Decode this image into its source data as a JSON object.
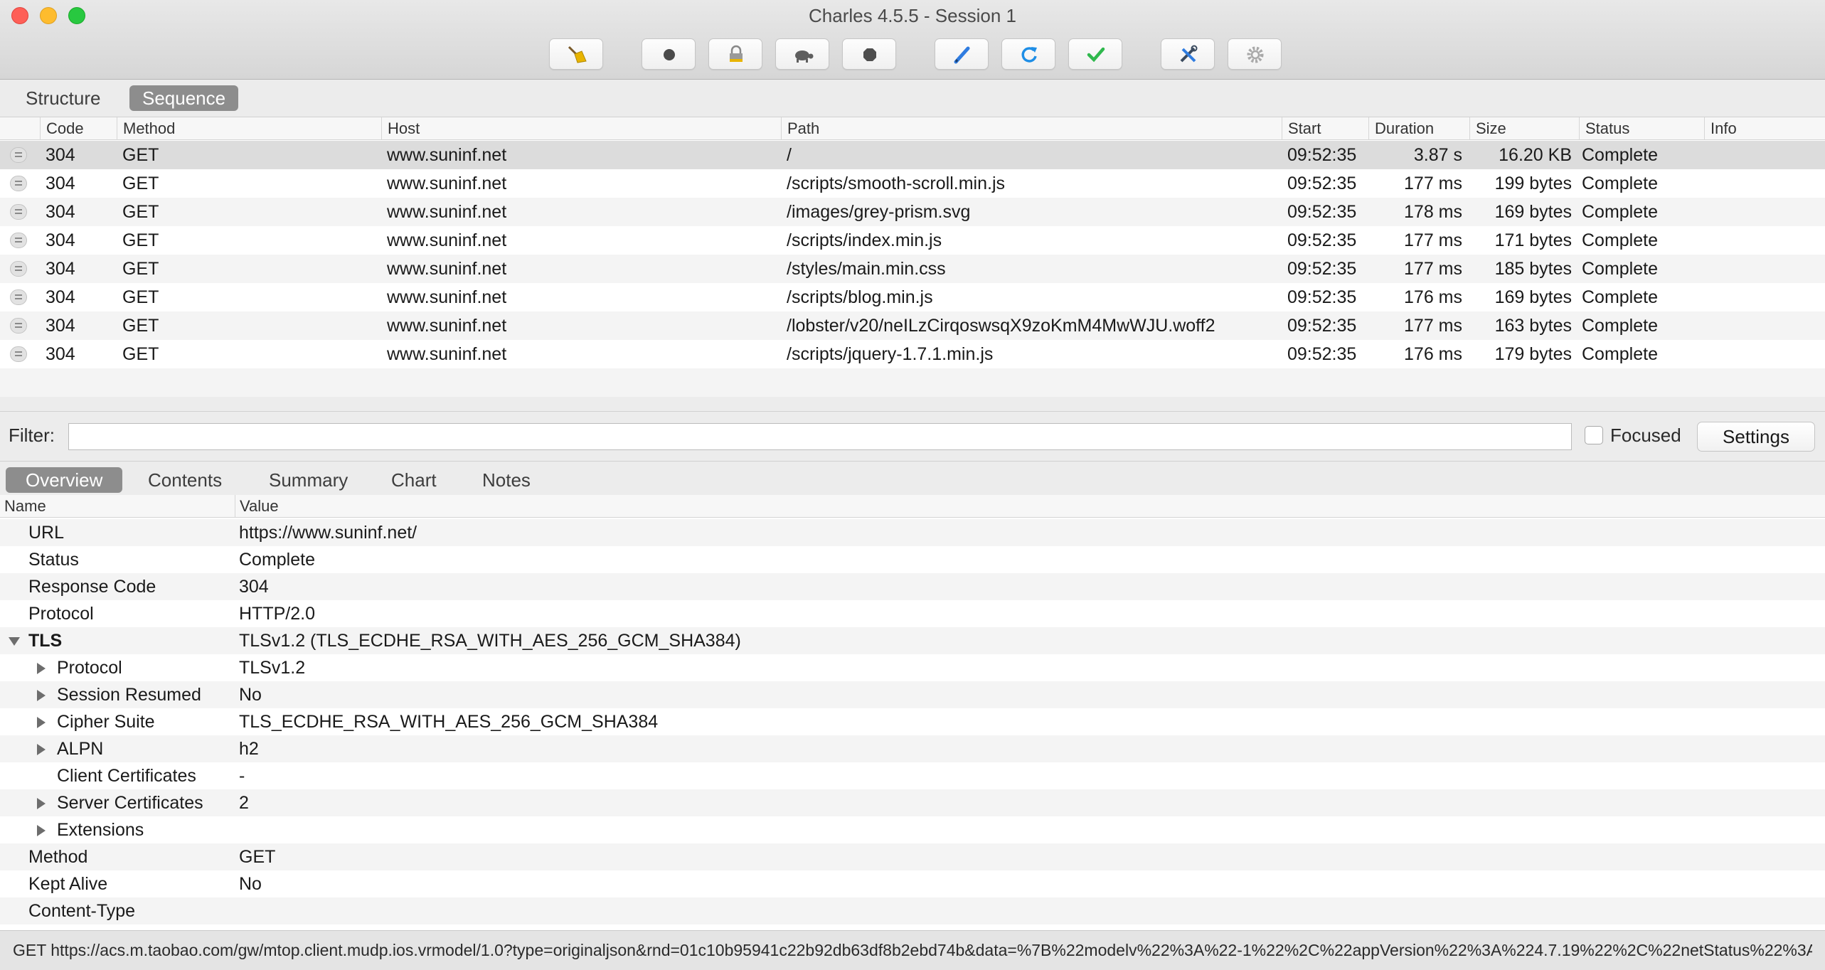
{
  "window": {
    "title": "Charles 4.5.5 - Session 1"
  },
  "toolbar": {
    "icons": [
      "broom-icon",
      "record-icon",
      "ssl-lock-icon",
      "turtle-throttle-icon",
      "breakpoint-stop-icon",
      "compose-pen-icon",
      "repeat-refresh-icon",
      "validate-check-icon",
      "tools-icon",
      "settings-gear-icon"
    ],
    "colors": {
      "pen": "#2f7ce0",
      "refresh": "#1e8ee6",
      "check": "#2fb84d",
      "broom": "#e8b400"
    }
  },
  "view_tabs": [
    "Structure",
    "Sequence"
  ],
  "view_tabs_active": "Sequence",
  "requests": {
    "columns": [
      "Code",
      "Method",
      "Host",
      "Path",
      "Start",
      "Duration",
      "Size",
      "Status",
      "Info"
    ],
    "rows": [
      {
        "code": "304",
        "method": "GET",
        "host": "www.suninf.net",
        "path": "/",
        "start": "09:52:35",
        "duration": "3.87 s",
        "size": "16.20 KB",
        "status": "Complete",
        "info": ""
      },
      {
        "code": "304",
        "method": "GET",
        "host": "www.suninf.net",
        "path": "/scripts/smooth-scroll.min.js",
        "start": "09:52:35",
        "duration": "177 ms",
        "size": "199 bytes",
        "status": "Complete",
        "info": ""
      },
      {
        "code": "304",
        "method": "GET",
        "host": "www.suninf.net",
        "path": "/images/grey-prism.svg",
        "start": "09:52:35",
        "duration": "178 ms",
        "size": "169 bytes",
        "status": "Complete",
        "info": ""
      },
      {
        "code": "304",
        "method": "GET",
        "host": "www.suninf.net",
        "path": "/scripts/index.min.js",
        "start": "09:52:35",
        "duration": "177 ms",
        "size": "171 bytes",
        "status": "Complete",
        "info": ""
      },
      {
        "code": "304",
        "method": "GET",
        "host": "www.suninf.net",
        "path": "/styles/main.min.css",
        "start": "09:52:35",
        "duration": "177 ms",
        "size": "185 bytes",
        "status": "Complete",
        "info": ""
      },
      {
        "code": "304",
        "method": "GET",
        "host": "www.suninf.net",
        "path": "/scripts/blog.min.js",
        "start": "09:52:35",
        "duration": "176 ms",
        "size": "169 bytes",
        "status": "Complete",
        "info": ""
      },
      {
        "code": "304",
        "method": "GET",
        "host": "www.suninf.net",
        "path": "/lobster/v20/neILzCirqoswsqX9zoKmM4MwWJU.woff2",
        "start": "09:52:35",
        "duration": "177 ms",
        "size": "163 bytes",
        "status": "Complete",
        "info": ""
      },
      {
        "code": "304",
        "method": "GET",
        "host": "www.suninf.net",
        "path": "/scripts/jquery-1.7.1.min.js",
        "start": "09:52:35",
        "duration": "176 ms",
        "size": "179 bytes",
        "status": "Complete",
        "info": ""
      }
    ]
  },
  "filter": {
    "label": "Filter:",
    "value": "",
    "placeholder": "",
    "focused_label": "Focused",
    "settings_label": "Settings"
  },
  "detail_tabs": [
    "Overview",
    "Contents",
    "Summary",
    "Chart",
    "Notes"
  ],
  "detail_tabs_active": "Overview",
  "overview": {
    "columns": [
      "Name",
      "Value"
    ],
    "rows": [
      {
        "name": "URL",
        "value": "https://www.suninf.net/",
        "level": 0,
        "toggle": "none",
        "bold": false
      },
      {
        "name": "Status",
        "value": "Complete",
        "level": 0,
        "toggle": "none",
        "bold": false
      },
      {
        "name": "Response Code",
        "value": "304",
        "level": 0,
        "toggle": "none",
        "bold": false
      },
      {
        "name": "Protocol",
        "value": "HTTP/2.0",
        "level": 0,
        "toggle": "none",
        "bold": false
      },
      {
        "name": "TLS",
        "value": "TLSv1.2 (TLS_ECDHE_RSA_WITH_AES_256_GCM_SHA384)",
        "level": 0,
        "toggle": "expanded",
        "bold": true
      },
      {
        "name": "Protocol",
        "value": "TLSv1.2",
        "level": 1,
        "toggle": "collapsed",
        "bold": false
      },
      {
        "name": "Session Resumed",
        "value": "No",
        "level": 1,
        "toggle": "collapsed",
        "bold": false
      },
      {
        "name": "Cipher Suite",
        "value": "TLS_ECDHE_RSA_WITH_AES_256_GCM_SHA384",
        "level": 1,
        "toggle": "collapsed",
        "bold": false
      },
      {
        "name": "ALPN",
        "value": "h2",
        "level": 1,
        "toggle": "collapsed",
        "bold": false
      },
      {
        "name": "Client Certificates",
        "value": "-",
        "level": 1,
        "toggle": "none",
        "bold": false
      },
      {
        "name": "Server Certificates",
        "value": "2",
        "level": 1,
        "toggle": "collapsed",
        "bold": false
      },
      {
        "name": "Extensions",
        "value": "",
        "level": 1,
        "toggle": "collapsed",
        "bold": false
      },
      {
        "name": "Method",
        "value": "GET",
        "level": 0,
        "toggle": "none",
        "bold": false
      },
      {
        "name": "Kept Alive",
        "value": "No",
        "level": 0,
        "toggle": "none",
        "bold": false
      },
      {
        "name": "Content-Type",
        "value": "",
        "level": 0,
        "toggle": "none",
        "bold": false
      }
    ]
  },
  "status_bar": {
    "text": "GET https://acs.m.taobao.com/gw/mtop.client.mudp.ios.vrmodel/1.0?type=originaljson&rnd=01c10b95941c22b92db63df8b2ebd74b&data=%7B%22modelv%22%3A%22-1%22%2C%22appVersion%22%3A%224.7.19%22%2C%22netStatus%22%3A..."
  }
}
